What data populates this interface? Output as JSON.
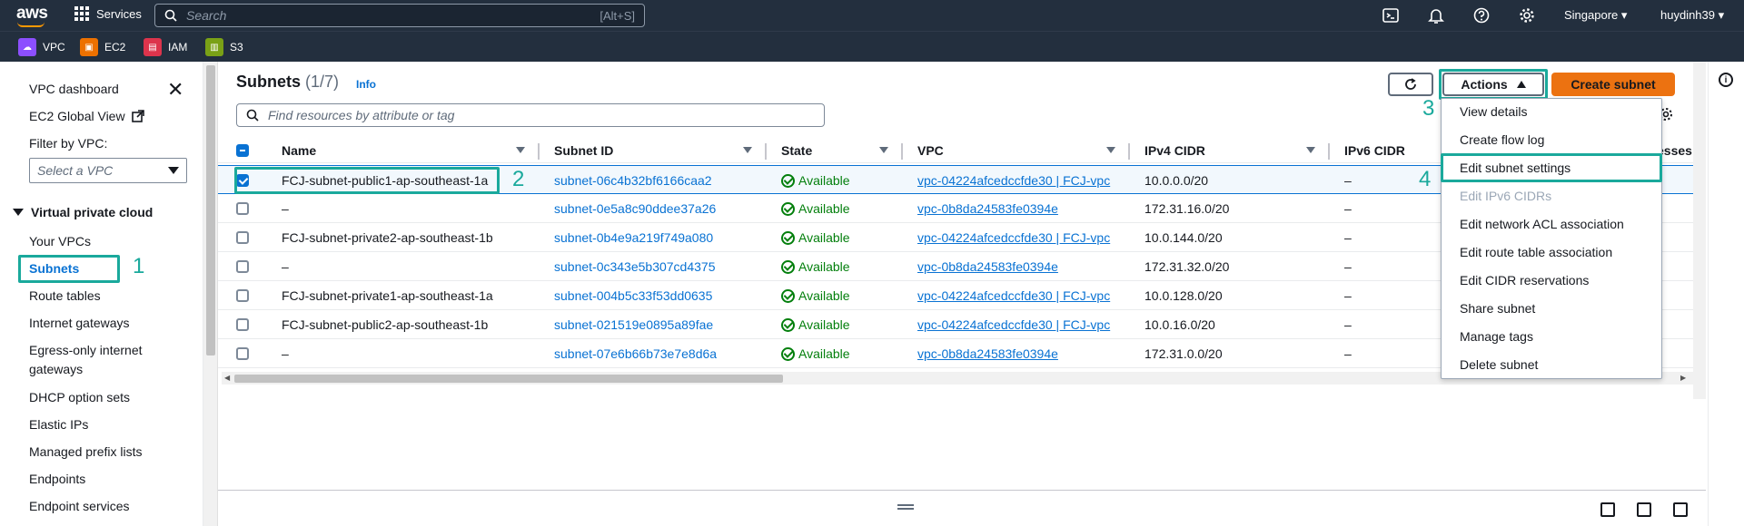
{
  "topbar": {
    "logo": "aws",
    "services": "Services",
    "search_placeholder": "Search",
    "search_shortcut": "[Alt+S]",
    "region": "Singapore ▾",
    "user": "huydinh39 ▾",
    "icons": [
      "cloudshell-icon",
      "bell-icon",
      "help-icon",
      "gear-icon"
    ]
  },
  "favorites": [
    {
      "label": "VPC",
      "color": "#8c4fff"
    },
    {
      "label": "EC2",
      "color": "#ed7100"
    },
    {
      "label": "IAM",
      "color": "#dd344c"
    },
    {
      "label": "S3",
      "color": "#7aa116"
    }
  ],
  "sidebar": {
    "dashboard": "VPC dashboard",
    "ec2_global": "EC2 Global View",
    "filter_label": "Filter by VPC:",
    "filter_placeholder": "Select a VPC",
    "section": "Virtual private cloud",
    "items": [
      "Your VPCs",
      "Subnets",
      "Route tables",
      "Internet gateways",
      "Egress-only internet",
      "gateways",
      "DHCP option sets",
      "Elastic IPs",
      "Managed prefix lists",
      "Endpoints",
      "Endpoint services"
    ]
  },
  "annotations": {
    "s1": "1",
    "s2": "2",
    "s3": "3",
    "s4": "4",
    "color": "#1aa99c"
  },
  "panel": {
    "title": "Subnets",
    "count": "(1/7)",
    "info": "Info",
    "actions": "Actions",
    "create": "Create subnet",
    "find_placeholder": "Find resources by attribute or tag"
  },
  "table": {
    "columns": [
      "Name",
      "Subnet ID",
      "State",
      "VPC",
      "IPv4 CIDR",
      "IPv6 CIDR",
      "esses"
    ],
    "rows": [
      {
        "name": "FCJ-subnet-public1-ap-southeast-1a",
        "id": "subnet-06c4b32bf6166caa2",
        "state": "Available",
        "vpc": "vpc-04224afcedccfde30 | FCJ-vpc",
        "cidr": "10.0.0.0/20",
        "ipv6": "–"
      },
      {
        "name": "–",
        "id": "subnet-0e5a8c90ddee37a26",
        "state": "Available",
        "vpc": "vpc-0b8da24583fe0394e",
        "cidr": "172.31.16.0/20",
        "ipv6": "–"
      },
      {
        "name": "FCJ-subnet-private2-ap-southeast-1b",
        "id": "subnet-0b4e9a219f749a080",
        "state": "Available",
        "vpc": "vpc-04224afcedccfde30 | FCJ-vpc",
        "cidr": "10.0.144.0/20",
        "ipv6": "–"
      },
      {
        "name": "–",
        "id": "subnet-0c343e5b307cd4375",
        "state": "Available",
        "vpc": "vpc-0b8da24583fe0394e",
        "cidr": "172.31.32.0/20",
        "ipv6": "–"
      },
      {
        "name": "FCJ-subnet-private1-ap-southeast-1a",
        "id": "subnet-004b5c33f53dd0635",
        "state": "Available",
        "vpc": "vpc-04224afcedccfde30 | FCJ-vpc",
        "cidr": "10.0.128.0/20",
        "ipv6": "–"
      },
      {
        "name": "FCJ-subnet-public2-ap-southeast-1b",
        "id": "subnet-021519e0895a89fae",
        "state": "Available",
        "vpc": "vpc-04224afcedccfde30 | FCJ-vpc",
        "cidr": "10.0.16.0/20",
        "ipv6": "–"
      },
      {
        "name": "–",
        "id": "subnet-07e6b66b73e7e8d6a",
        "state": "Available",
        "vpc": "vpc-0b8da24583fe0394e",
        "cidr": "172.31.0.0/20",
        "ipv6": "–"
      }
    ]
  },
  "menu": {
    "items": [
      "View details",
      "Create flow log",
      "Edit subnet settings",
      "Edit IPv6 CIDRs",
      "Edit network ACL association",
      "Edit route table association",
      "Edit CIDR reservations",
      "Share subnet",
      "Manage tags",
      "Delete subnet"
    ]
  }
}
